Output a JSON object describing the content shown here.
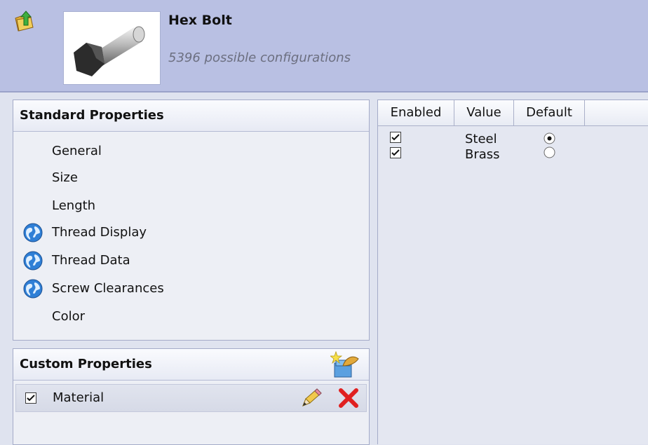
{
  "header": {
    "title": "Hex Bolt",
    "subtitle": "5396 possible configurations",
    "back_icon": "folder-up-arrow-icon",
    "thumbnail": "hex-bolt-image"
  },
  "standard_properties": {
    "title": "Standard Properties",
    "items": [
      {
        "label": "General",
        "icon": ""
      },
      {
        "label": "Size",
        "icon": ""
      },
      {
        "label": "Length",
        "icon": ""
      },
      {
        "label": "Thread Display",
        "icon": "globe-icon"
      },
      {
        "label": "Thread Data",
        "icon": "globe-icon"
      },
      {
        "label": "Screw Clearances",
        "icon": "globe-icon"
      },
      {
        "label": "Color",
        "icon": ""
      }
    ]
  },
  "custom_properties": {
    "title": "Custom Properties",
    "items": [
      {
        "label": "Material",
        "checked": true
      }
    ]
  },
  "values_table": {
    "columns": [
      "Enabled",
      "Value",
      "Default"
    ],
    "rows": [
      {
        "enabled": true,
        "value": "Steel",
        "default": true
      },
      {
        "enabled": true,
        "value": "Brass",
        "default": false
      }
    ]
  },
  "colors": {
    "header_bg": "#b9c0e3",
    "panel_bg": "#eef0f6",
    "delete_red": "#e02020"
  }
}
